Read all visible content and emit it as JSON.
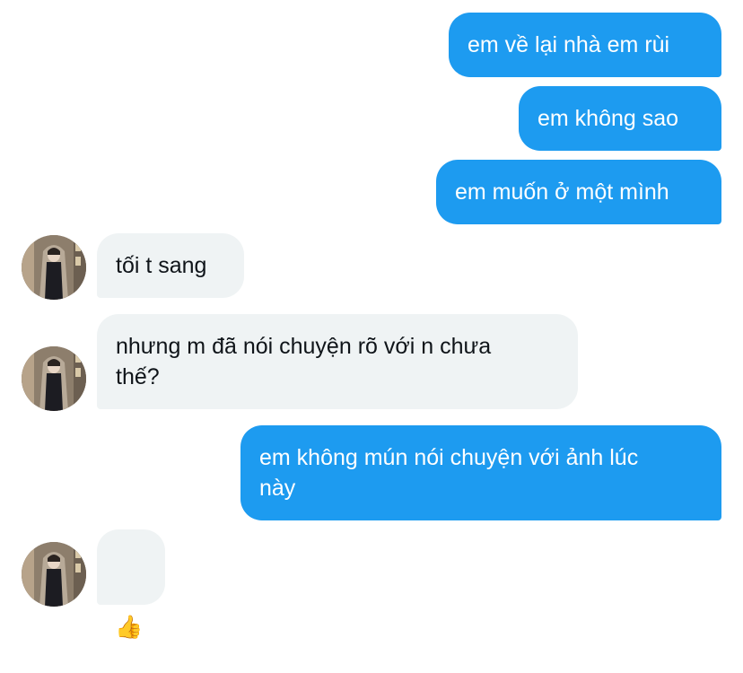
{
  "conversation": {
    "messages": [
      {
        "side": "sent",
        "text": "em về lại nhà em rùi"
      },
      {
        "side": "sent",
        "text": "em không sao"
      },
      {
        "side": "sent",
        "text": "em muốn ở một mình"
      },
      {
        "side": "received",
        "text": "tối t sang"
      },
      {
        "side": "received",
        "text": "nhưng m đã nói chuyện rõ với n chưa\nthế?"
      },
      {
        "side": "sent",
        "text": "em không mún nói chuyện với ảnh lúc\nnày"
      },
      {
        "side": "received",
        "text": "👍"
      }
    ],
    "colors": {
      "sent_bubble": "#1d9bf0",
      "received_bubble": "#eff3f4",
      "sent_text": "#ffffff",
      "received_text": "#0f1419"
    }
  }
}
